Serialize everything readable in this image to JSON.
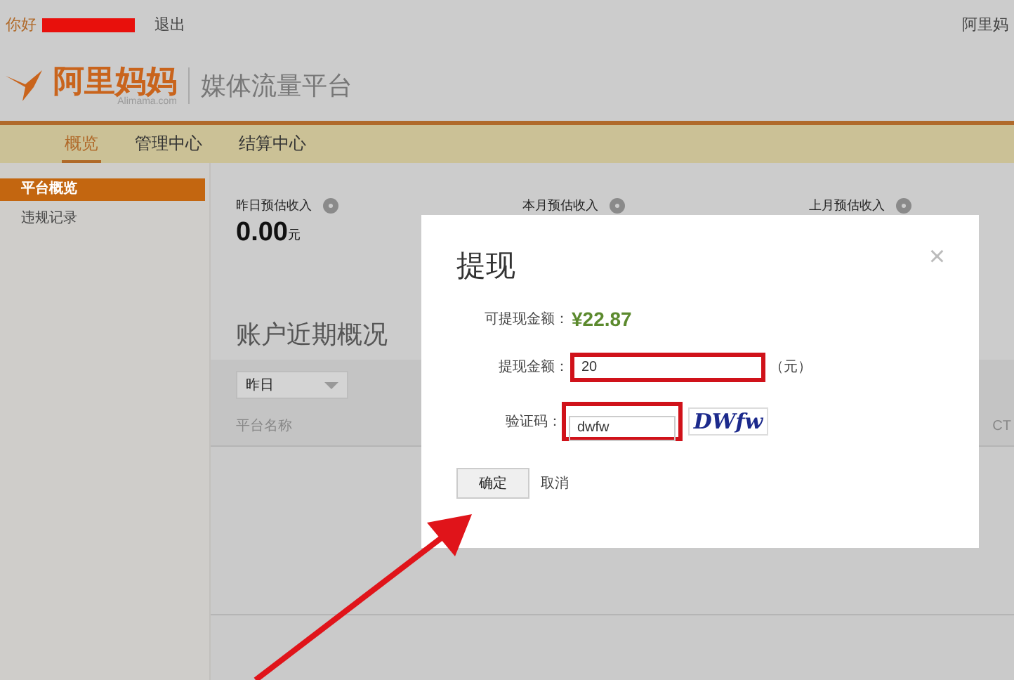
{
  "topbar": {
    "greeting": "你好",
    "logout": "退出",
    "right_text": "阿里妈"
  },
  "header": {
    "logo_text": "阿里妈妈",
    "logo_sub": "Alimama.com",
    "platform": "媒体流量平台"
  },
  "tabs": [
    {
      "label": "概览",
      "selected": true
    },
    {
      "label": "管理中心",
      "selected": false
    },
    {
      "label": "结算中心",
      "selected": false
    }
  ],
  "sidebar": {
    "items": [
      {
        "label": "平台概览",
        "selected": true
      },
      {
        "label": "违规记录",
        "selected": false
      }
    ]
  },
  "stats": [
    {
      "label": "昨日预估收入",
      "value": "0.00",
      "unit": "元"
    },
    {
      "label": "本月预估收入"
    },
    {
      "label": "上月预估收入"
    }
  ],
  "overview": {
    "heading": "账户近期概况",
    "period": "昨日",
    "columns": [
      "平台名称",
      "CT"
    ]
  },
  "dialog": {
    "title": "提现",
    "close": "×",
    "available_label": "可提现金额：",
    "available": "¥22.87",
    "amount_label": "提现金额：",
    "amount": "20",
    "amount_unit": "（元）",
    "captcha_label": "验证码：",
    "captcha": "dwfw",
    "captcha_image": "DWfw",
    "buttons": {
      "ok": "确定",
      "cancel": "取消"
    }
  }
}
